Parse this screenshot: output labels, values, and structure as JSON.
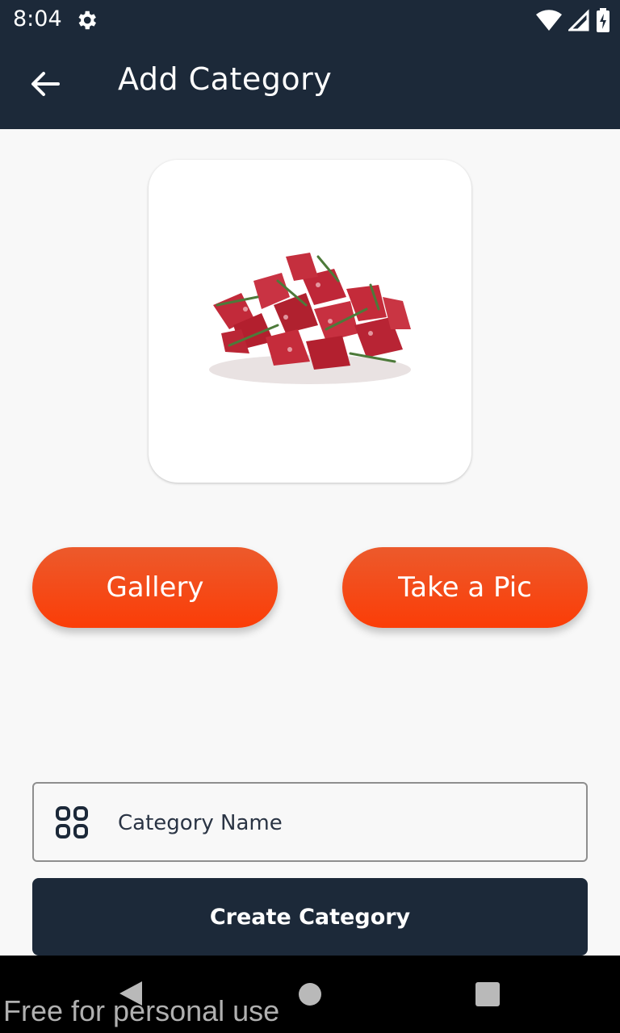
{
  "status_bar": {
    "time": "8:04",
    "icons": [
      "settings-gear-icon",
      "wifi-icon",
      "signal-icon",
      "battery-charging-icon"
    ]
  },
  "app_bar": {
    "title": "Add Category",
    "back_icon": "arrow-left-icon"
  },
  "image_preview": {
    "description_icon": "meat-image"
  },
  "buttons": {
    "gallery": "Gallery",
    "take_pic": "Take a Pic",
    "create": "Create Category"
  },
  "category_field": {
    "placeholder": "Category Name",
    "value": "",
    "icon": "grid-icon"
  },
  "colors": {
    "dark": "#1c2939",
    "accent_top": "#ec5a2c",
    "accent_bottom": "#fb3d07",
    "background": "#f8f8f8"
  },
  "watermark": "Free for personal use"
}
